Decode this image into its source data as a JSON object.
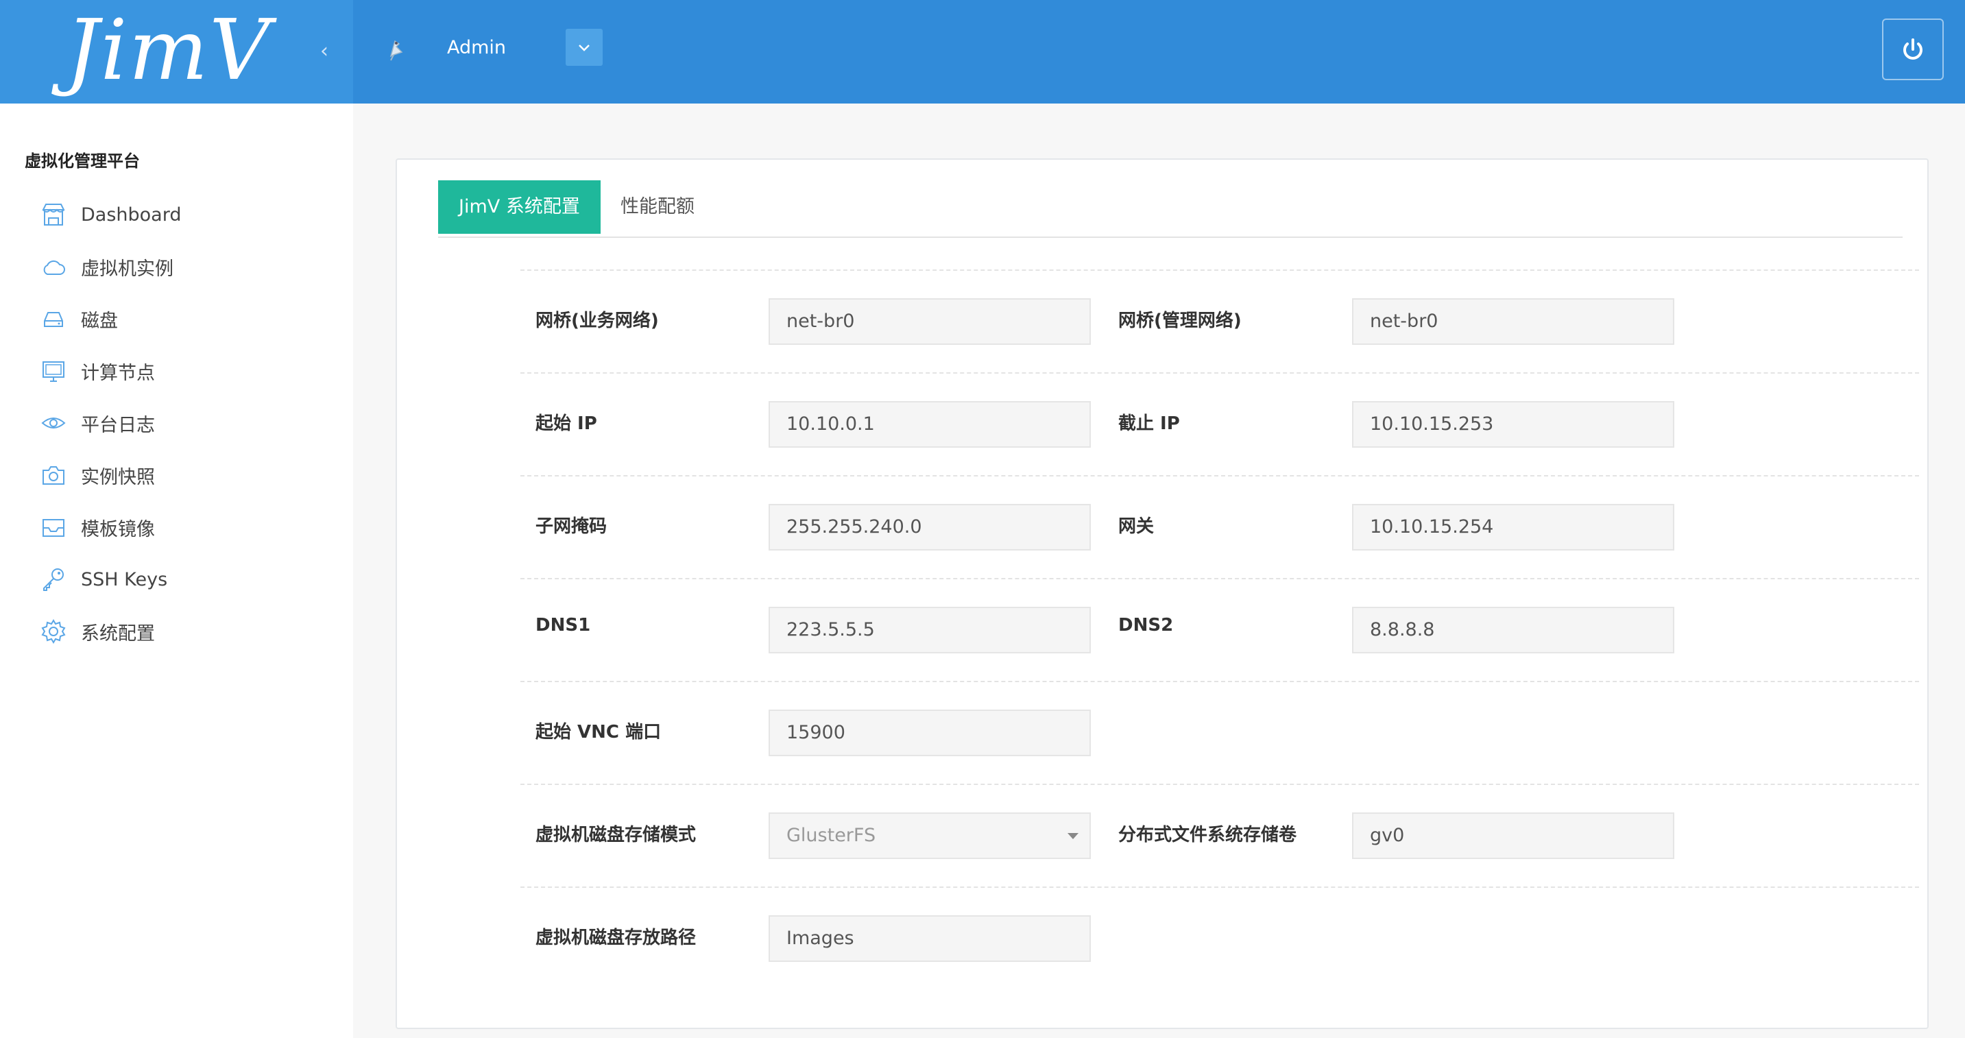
{
  "header": {
    "brand": "JimV",
    "collapse_icon": "chevron-left-icon",
    "user_name": "Admin",
    "dropdown_icon": "chevron-down-icon",
    "power_icon": "power-icon"
  },
  "sidebar": {
    "title": "虚拟化管理平台",
    "items": [
      {
        "label": "Dashboard",
        "icon": "store-icon"
      },
      {
        "label": "虚拟机实例",
        "icon": "cloud-icon"
      },
      {
        "label": "磁盘",
        "icon": "drive-icon"
      },
      {
        "label": "计算节点",
        "icon": "monitor-icon"
      },
      {
        "label": "平台日志",
        "icon": "eye-icon"
      },
      {
        "label": "实例快照",
        "icon": "camera-icon"
      },
      {
        "label": "模板镜像",
        "icon": "inbox-icon"
      },
      {
        "label": "SSH Keys",
        "icon": "key-icon"
      },
      {
        "label": "系统配置",
        "icon": "gear-icon"
      }
    ]
  },
  "tabs": [
    {
      "label": "JimV 系统配置",
      "active": true
    },
    {
      "label": "性能配额",
      "active": false
    }
  ],
  "form": {
    "bridge_business_label": "网桥(业务网络)",
    "bridge_business_value": "net-br0",
    "bridge_mgmt_label": "网桥(管理网络)",
    "bridge_mgmt_value": "net-br0",
    "start_ip_label": "起始 IP",
    "start_ip_value": "10.10.0.1",
    "end_ip_label": "截止 IP",
    "end_ip_value": "10.10.15.253",
    "netmask_label": "子网掩码",
    "netmask_value": "255.255.240.0",
    "gateway_label": "网关",
    "gateway_value": "10.10.15.254",
    "dns1_label": "DNS1",
    "dns1_value": "223.5.5.5",
    "dns2_label": "DNS2",
    "dns2_value": "8.8.8.8",
    "vnc_port_label": "起始 VNC 端口",
    "vnc_port_value": "15900",
    "storage_mode_label": "虚拟机磁盘存储模式",
    "storage_mode_value": "GlusterFS",
    "dfs_volume_label": "分布式文件系统存储卷",
    "dfs_volume_value": "gv0",
    "storage_path_label": "虚拟机磁盘存放路径",
    "storage_path_value": "Images"
  },
  "colors": {
    "header": "#318bd9",
    "brand_bg": "#3a95e0",
    "tab_active": "#1fb89b"
  }
}
